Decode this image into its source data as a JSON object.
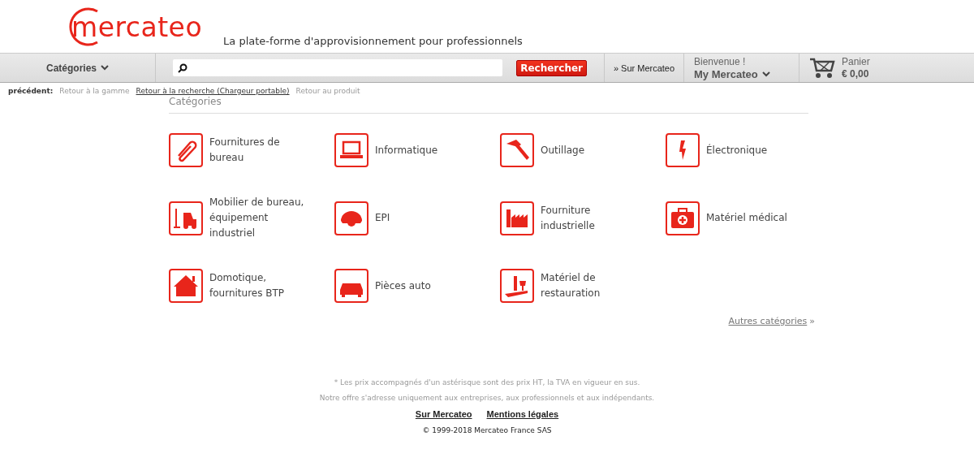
{
  "header": {
    "logo": "mercateo",
    "tagline": "La plate-forme d'approvisionnement pour professionnels"
  },
  "nav": {
    "categories": "Catégories",
    "search_button": "Rechercher",
    "about": "» Sur Mercateo",
    "welcome": "Bienvenue !",
    "account": "My Mercateo",
    "cart_label": "Panier",
    "cart_total": "€ 0,00"
  },
  "breadcrumb": {
    "label": "précédent:",
    "links": [
      {
        "text": "Retour à la gamme",
        "selected": false
      },
      {
        "text": "Retour à la recherche (Chargeur portable)",
        "selected": true
      },
      {
        "text": "Retour au produit",
        "selected": false
      }
    ]
  },
  "section_title": "Catégories",
  "categories": [
    "Fournitures de bureau",
    "Informatique",
    "Outillage",
    "Électronique",
    "Mobilier de bureau, équipement industriel",
    "EPI",
    "Fourniture industrielle",
    "Matériel médical",
    "Domotique, fournitures BTP",
    "Pièces auto",
    "Matériel de restauration"
  ],
  "more_link": "Autres catégories",
  "more_mark": "»",
  "footer": {
    "notes": [
      "* Les prix accompagnés d'un astérisque sont des prix HT, la TVA en vigueur en sus.",
      "Notre offre s'adresse uniquement aux entreprises, aux professionnels et aux indépendants."
    ],
    "links": [
      "Sur Mercateo",
      "Mentions légales"
    ],
    "copyright": "© 1999-2018 Mercateo France SAS"
  }
}
